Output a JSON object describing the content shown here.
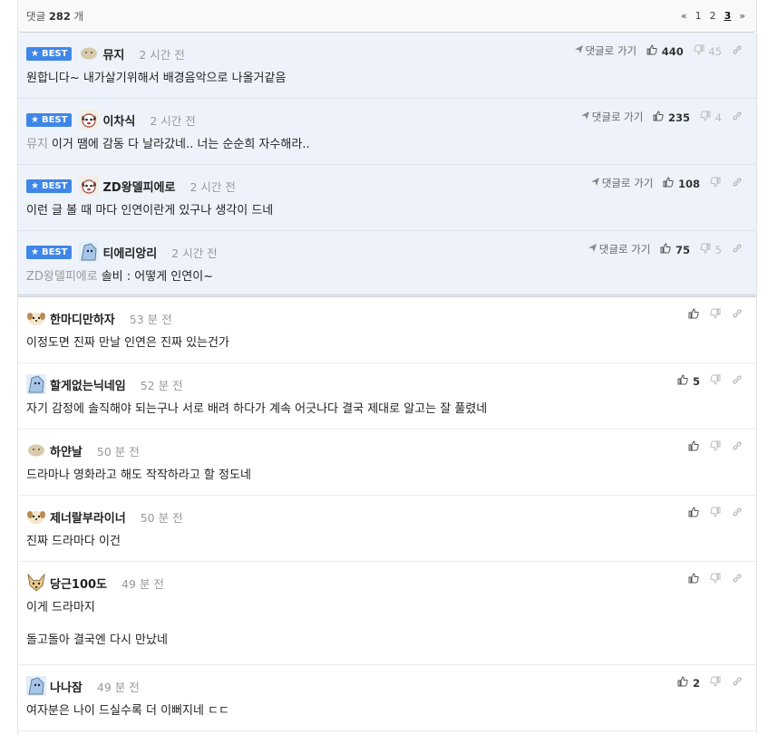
{
  "header": {
    "count_prefix": "댓글",
    "count_value": "282",
    "count_suffix": "개",
    "pager": {
      "prev": "«",
      "pages": [
        "1",
        "2",
        "3"
      ],
      "current": "3",
      "next": "»"
    }
  },
  "labels": {
    "best": "BEST",
    "goto": "댓글로 가기"
  },
  "best_comments": [
    {
      "nick": "뮤지",
      "time": "2 시간 전",
      "reply_to": "",
      "text": "원합니다~ 내가살기위해서 배경음악으로 나올거같음",
      "likes": "440",
      "dislikes": "45",
      "avatar": "blob"
    },
    {
      "nick": "이차식",
      "time": "2 시간 전",
      "reply_to": "뮤지",
      "text": "이거 땜에 감동 다 날라갔네.. 너는 순순희 자수해라..",
      "likes": "235",
      "dislikes": "4",
      "avatar": "dog"
    },
    {
      "nick": "ZD왕델피에로",
      "time": "2 시간 전",
      "reply_to": "",
      "text": "이런 글 볼 때 마다 인연이란게 있구나 생각이 드네",
      "likes": "108",
      "dislikes": "",
      "avatar": "dog"
    },
    {
      "nick": "티에리앙리",
      "time": "2 시간 전",
      "reply_to": "ZD왕델피에로",
      "text": "솔비 : 어떻게 인연이~",
      "likes": "75",
      "dislikes": "5",
      "avatar": "ice"
    }
  ],
  "comments": [
    {
      "nick": "한마디만하자",
      "time": "53 분 전",
      "text": [
        "이정도면 진짜 만날 인연은 진짜 있는건가"
      ],
      "likes": "",
      "avatar": "pup"
    },
    {
      "nick": "할게없는닉네임",
      "time": "52 분 전",
      "text": [
        "자기 감정에 솔직해야 되는구나 서로 배려 하다가 계속 어긋나다 결국 제대로 알고는 잘 풀렸네"
      ],
      "likes": "5",
      "avatar": "ice"
    },
    {
      "nick": "하얀날",
      "time": "50 분 전",
      "text": [
        "드라마나 영화라고 해도 작작하라고 할 정도네"
      ],
      "likes": "",
      "avatar": "blob"
    },
    {
      "nick": "제너랄부라이너",
      "time": "50 분 전",
      "text": [
        "진짜 드라마다 이건"
      ],
      "likes": "",
      "avatar": "pup"
    },
    {
      "nick": "당근100도",
      "time": "49 분 전",
      "text": [
        "이게 드라마지",
        "돌고돌아 결국엔 다시 만났네"
      ],
      "likes": "",
      "avatar": "fox"
    },
    {
      "nick": "나나잠",
      "time": "49 분 전",
      "text": [
        "여자분은 나이 드실수록 더 이뻐지네 ㄷㄷ"
      ],
      "likes": "2",
      "avatar": "ice"
    }
  ]
}
